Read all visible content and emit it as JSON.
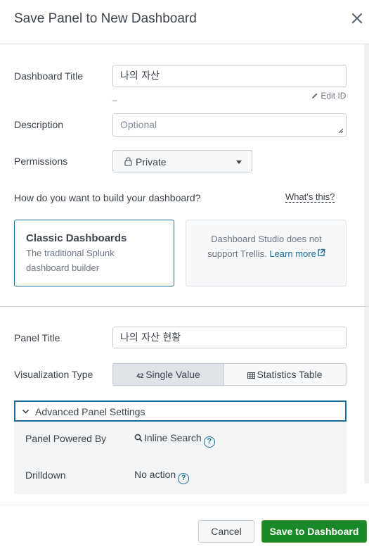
{
  "dialog": {
    "title": "Save Panel to New Dashboard"
  },
  "form": {
    "dashboard_title_label": "Dashboard Title",
    "dashboard_title_value": "나의 자산",
    "id_value": "_",
    "edit_id_label": "Edit ID",
    "description_label": "Description",
    "description_placeholder": "Optional",
    "permissions_label": "Permissions",
    "permissions_value": "Private",
    "build_question": "How do you want to build your dashboard?",
    "whats_this": "What's this?"
  },
  "cards": {
    "classic_title": "Classic Dashboards",
    "classic_desc": "The traditional Splunk dashboard builder",
    "studio_msg": "Dashboard Studio does not support Trellis.",
    "learn_more": "Learn more"
  },
  "panel": {
    "title_label": "Panel Title",
    "title_value": "나의 자산 현황",
    "viz_label": "Visualization Type",
    "viz_single_badge": "42",
    "viz_single": "Single Value",
    "viz_table": "Statistics Table"
  },
  "advanced": {
    "header": "Advanced Panel Settings",
    "powered_label": "Panel Powered By",
    "powered_value": "Inline Search",
    "drilldown_label": "Drilldown",
    "drilldown_value": "No action"
  },
  "footer": {
    "cancel": "Cancel",
    "save": "Save to Dashboard"
  },
  "colors": {
    "accent": "#1a6fa0",
    "primary_button": "#1a8929"
  }
}
